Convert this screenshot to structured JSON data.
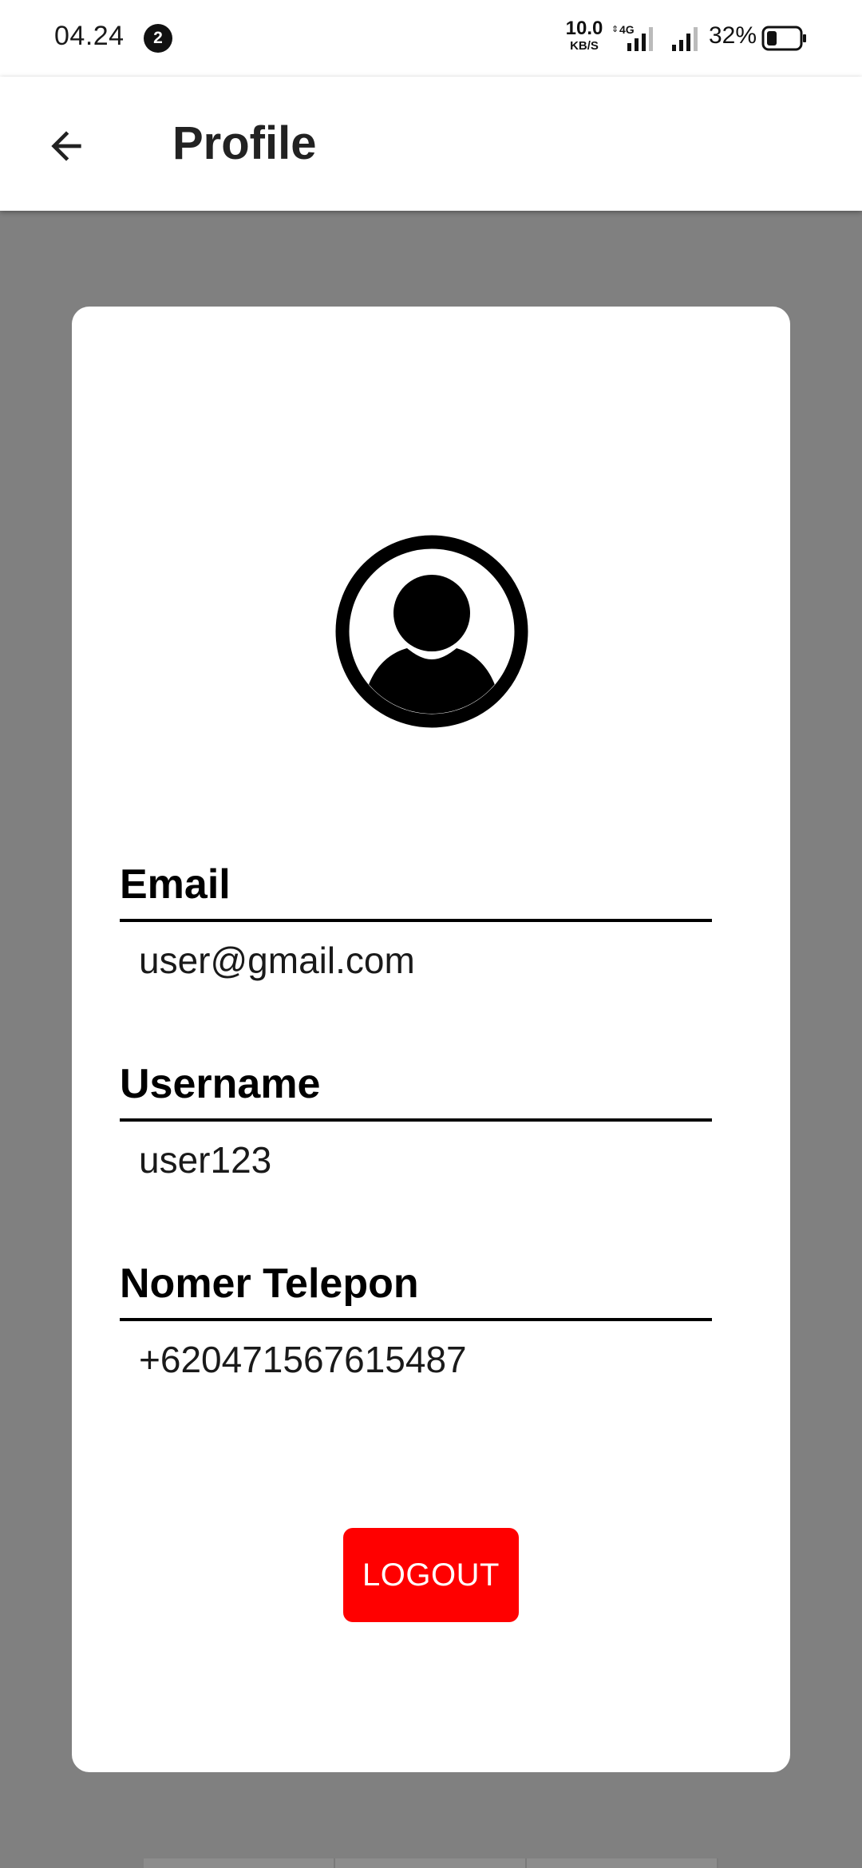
{
  "status_bar": {
    "time": "04.24",
    "notification_count": "2",
    "net_speed_value": "10.0",
    "net_speed_unit": "KB/S",
    "network_type": "4G",
    "battery_percent": "32%",
    "battery_level": 0.32
  },
  "app_bar": {
    "back_icon": "arrow-left-icon",
    "title": "Profile"
  },
  "profile": {
    "avatar_icon": "account-circle-icon",
    "fields": [
      {
        "label": "Email",
        "value": "user@gmail.com"
      },
      {
        "label": "Username",
        "value": "user123"
      },
      {
        "label": "Nomer Telepon",
        "value": "+620471567615487"
      }
    ],
    "logout_label": "LOGOUT"
  },
  "colors": {
    "background": "#808080",
    "card": "#ffffff",
    "logout_button": "#ff0000",
    "text": "#000000"
  }
}
